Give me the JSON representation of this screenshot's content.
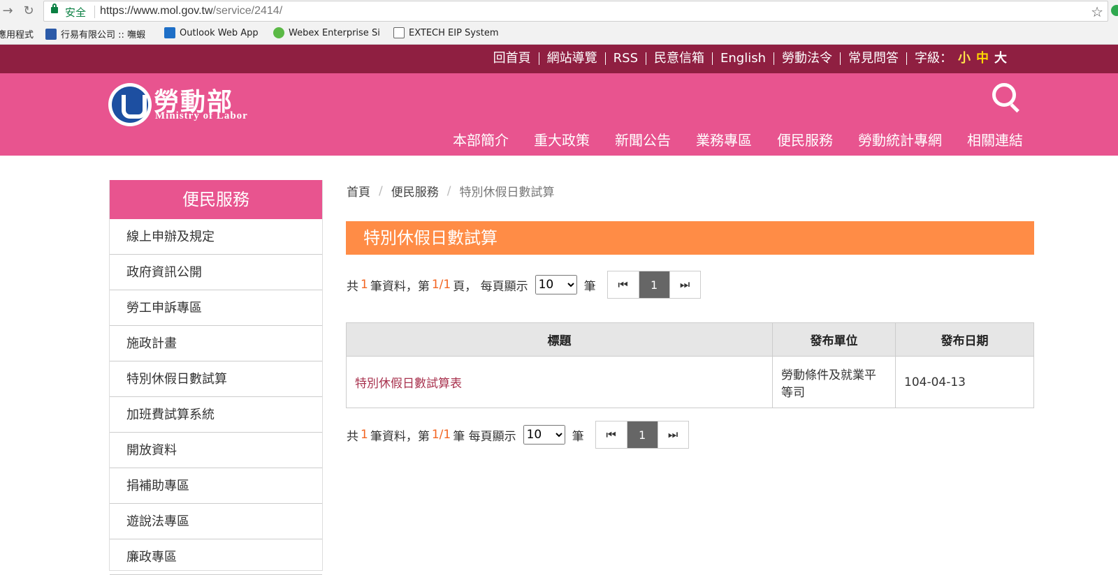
{
  "browser": {
    "secure_label": "安全",
    "url_host": "https://www.mol.gov.tw",
    "url_path": "/service/2414/",
    "bookmarks": [
      "應用程式",
      "行易有限公司 :: 嘸蝦",
      "Outlook Web App",
      "Webex Enterprise Si",
      "EXTECH EIP System"
    ]
  },
  "topbar": {
    "links": [
      "回首頁",
      "網站導覽",
      "RSS",
      "民意信箱",
      "English",
      "勞動法令",
      "常見問答"
    ],
    "font_size_label": "字級：",
    "font_sizes": [
      "小",
      "中",
      "大"
    ]
  },
  "header": {
    "logo_cn": "勞動部",
    "logo_en": "Ministry of Labor",
    "nav": [
      "本部簡介",
      "重大政策",
      "新聞公告",
      "業務專區",
      "便民服務",
      "勞動統計專網",
      "相關連結"
    ]
  },
  "sidebar": {
    "title": "便民服務",
    "items": [
      "線上申辦及規定",
      "政府資訊公開",
      "勞工申訴專區",
      "施政計畫",
      "特別休假日數試算",
      "加班費試算系統",
      "開放資料",
      "捐補助專區",
      "遊說法專區",
      "廉政專區"
    ]
  },
  "breadcrumb": [
    "首頁",
    "便民服務",
    "特別休假日數試算"
  ],
  "page_title": "特別休假日數試算",
  "pager_top": {
    "p1": "共",
    "count": "1",
    "p2": "筆資料，第",
    "page": "1/1",
    "p3": "頁， 每頁顯示",
    "per_page": "10",
    "p4": "筆",
    "current": "1"
  },
  "pager_bottom": {
    "p1": "共",
    "count": "1",
    "p2": "筆資料，第",
    "page": "1/1",
    "p3": "筆 每頁顯示",
    "per_page": "10",
    "p4": "筆",
    "current": "1"
  },
  "table": {
    "headers": [
      "標題",
      "發布單位",
      "發布日期"
    ],
    "rows": [
      {
        "title": "特別休假日數試算表",
        "unit": "勞動條件及就業平等司",
        "date": "104-04-13"
      }
    ]
  }
}
